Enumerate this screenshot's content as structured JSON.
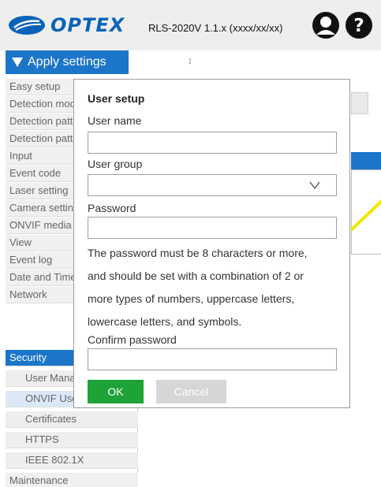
{
  "header": {
    "logo_text": "OPTEX",
    "version": "RLS-2020V 1.1.x (xxxx/xx/xx)",
    "icons": [
      "user-icon",
      "help-icon"
    ],
    "brand_color": "#0a63b8"
  },
  "toolbar": {
    "apply_label": "Apply settings",
    "resize_glyph": "↕"
  },
  "sidebar": {
    "items": [
      {
        "label": "Easy setup"
      },
      {
        "label": "Detection mode"
      },
      {
        "label": "Detection pattern"
      },
      {
        "label": "Detection pattern"
      },
      {
        "label": "Input"
      },
      {
        "label": "Event code"
      },
      {
        "label": "Laser setting"
      },
      {
        "label": "Camera setting"
      },
      {
        "label": "ONVIF media"
      },
      {
        "label": "View"
      },
      {
        "label": "Event log"
      },
      {
        "label": "Date and Time"
      },
      {
        "label": "Network"
      },
      {
        "label": "Security"
      },
      {
        "label": "User Management"
      },
      {
        "label": "ONVIF User"
      },
      {
        "label": "Certificates"
      },
      {
        "label": "HTTPS"
      },
      {
        "label": "IEEE 802.1X"
      },
      {
        "label": "Maintenance"
      }
    ],
    "active_color": "#1b75c9"
  },
  "dialog": {
    "title": "User setup",
    "username_label": "User name",
    "username_value": "",
    "group_label": "User group",
    "group_value": "",
    "password_label": "Password",
    "password_value": "",
    "hint_lines": [
      "The password must be 8 characters or more,",
      "and should be set with a combination of 2 or",
      "more types of numbers, uppercase letters,",
      "lowercase letters, and symbols."
    ],
    "confirm_label": "Confirm password",
    "confirm_value": "",
    "ok_label": "OK",
    "cancel_label": "Cancel",
    "ok_color": "#1da336",
    "cancel_color": "#d6d6d6"
  }
}
